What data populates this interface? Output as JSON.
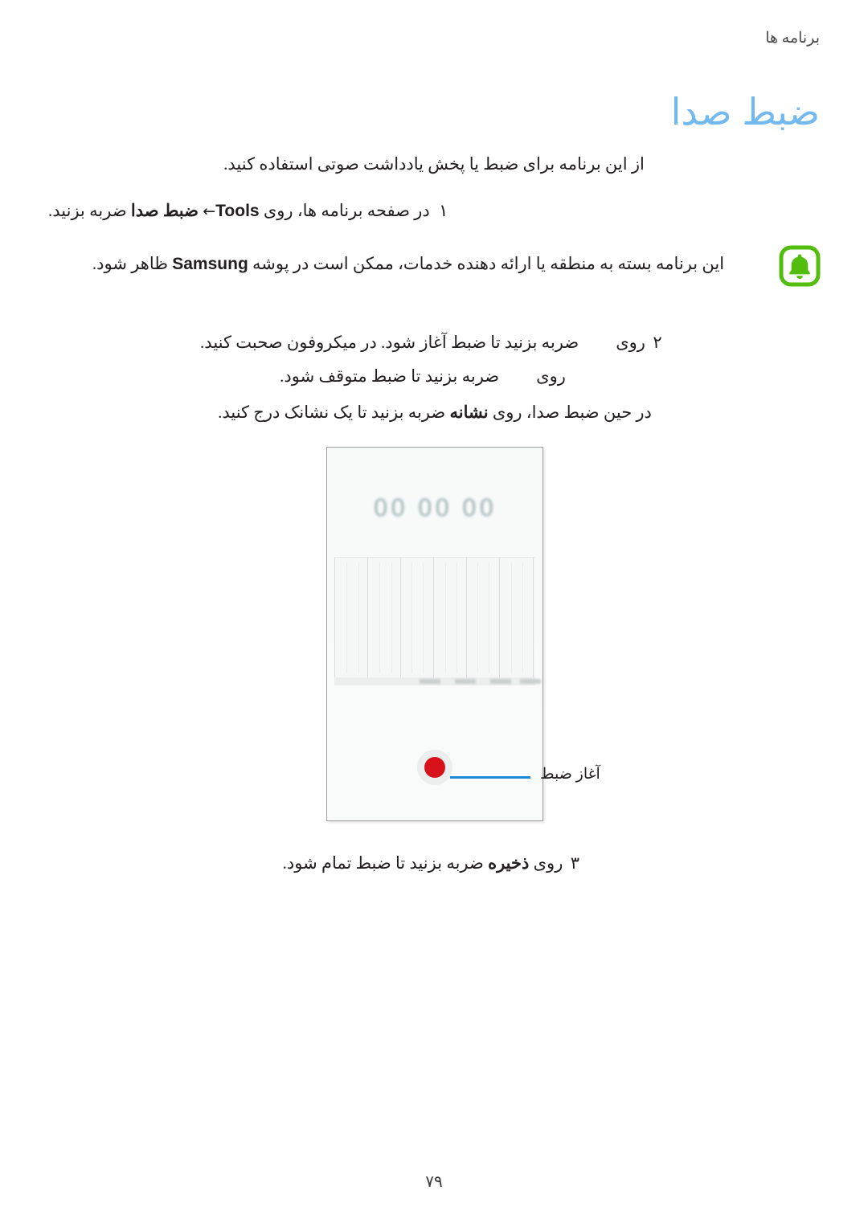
{
  "header": {
    "running_head": "برنامه ها"
  },
  "title": {
    "text": "ضبط صدا",
    "color": "#72b9ef"
  },
  "intro": {
    "text": "از این برنامه برای ضبط یا پخش یادداشت صوتی استفاده کنید."
  },
  "steps": [
    {
      "number": "۱",
      "prefix": "در صفحه برنامه ها، روی ",
      "app_name": "Tools",
      "arrow": "←",
      "bold_target": "ضبط صدا",
      "suffix": " ضربه بزنید."
    },
    {
      "number": "۲",
      "lead": "روی",
      "tail": "ضربه بزنید تا ضبط آغاز شود. در میکروفون صحبت کنید."
    },
    {
      "number": "",
      "lead": "روی",
      "tail": "ضربه بزنید تا ضبط متوقف شود."
    }
  ],
  "note": {
    "icon": "bell-icon",
    "icon_color": "#52bd0c",
    "text": "این برنامه بسته به منطقه یا ارائه دهنده خدمات، ممکن است در پوشه Samsung ظاهر شود.",
    "latin_word": "Samsung",
    "text_before": "این برنامه بسته به منطقه یا ارائه دهنده خدمات، ممکن است در پوشه ",
    "text_after": " ظاهر شود."
  },
  "bookmark_tip": {
    "prefix": "در حین ضبط صدا، روی ",
    "bold_target": "نشانه",
    "suffix": " ضربه بزنید تا یک نشانک درج کنید."
  },
  "figure": {
    "name": "voice-recorder-screenshot",
    "timer": "00 00 00",
    "record_button_color": "#d8121a",
    "callout": {
      "label": "آغاز ضبط",
      "line_color": "#1a8ad4"
    }
  },
  "step3": {
    "number": "۳",
    "prefix": "روی ",
    "bold_target": "ذخیره",
    "suffix": " ضربه بزنید تا ضبط تمام شود."
  },
  "footer": {
    "page_number": "۷۹"
  }
}
